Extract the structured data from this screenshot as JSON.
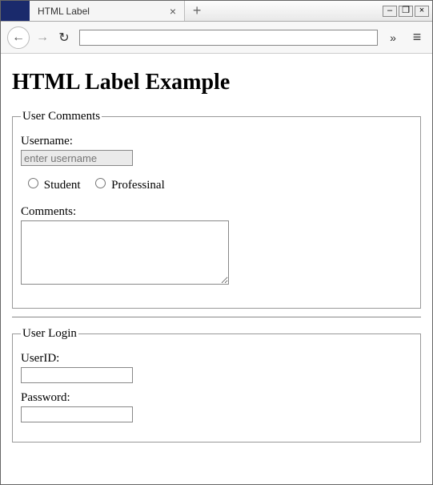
{
  "browser": {
    "tab_title": "HTML Label",
    "close_glyph": "×",
    "newtab_glyph": "+",
    "min_glyph": "–",
    "max_glyph": "❐",
    "closewin_glyph": "×",
    "back_glyph": "←",
    "fwd_glyph": "→",
    "reload_glyph": "↻",
    "url_value": "",
    "overflow_glyph": "»",
    "menu_glyph": "≡"
  },
  "page": {
    "heading": "HTML Label Example",
    "comments": {
      "legend": "User Comments",
      "username_label": "Username:",
      "username_placeholder": "enter username",
      "radio_student": "Student",
      "radio_professional": "Professinal",
      "comments_label": "Comments:"
    },
    "login": {
      "legend": "User Login",
      "userid_label": "UserID:",
      "password_label": "Password:"
    }
  }
}
